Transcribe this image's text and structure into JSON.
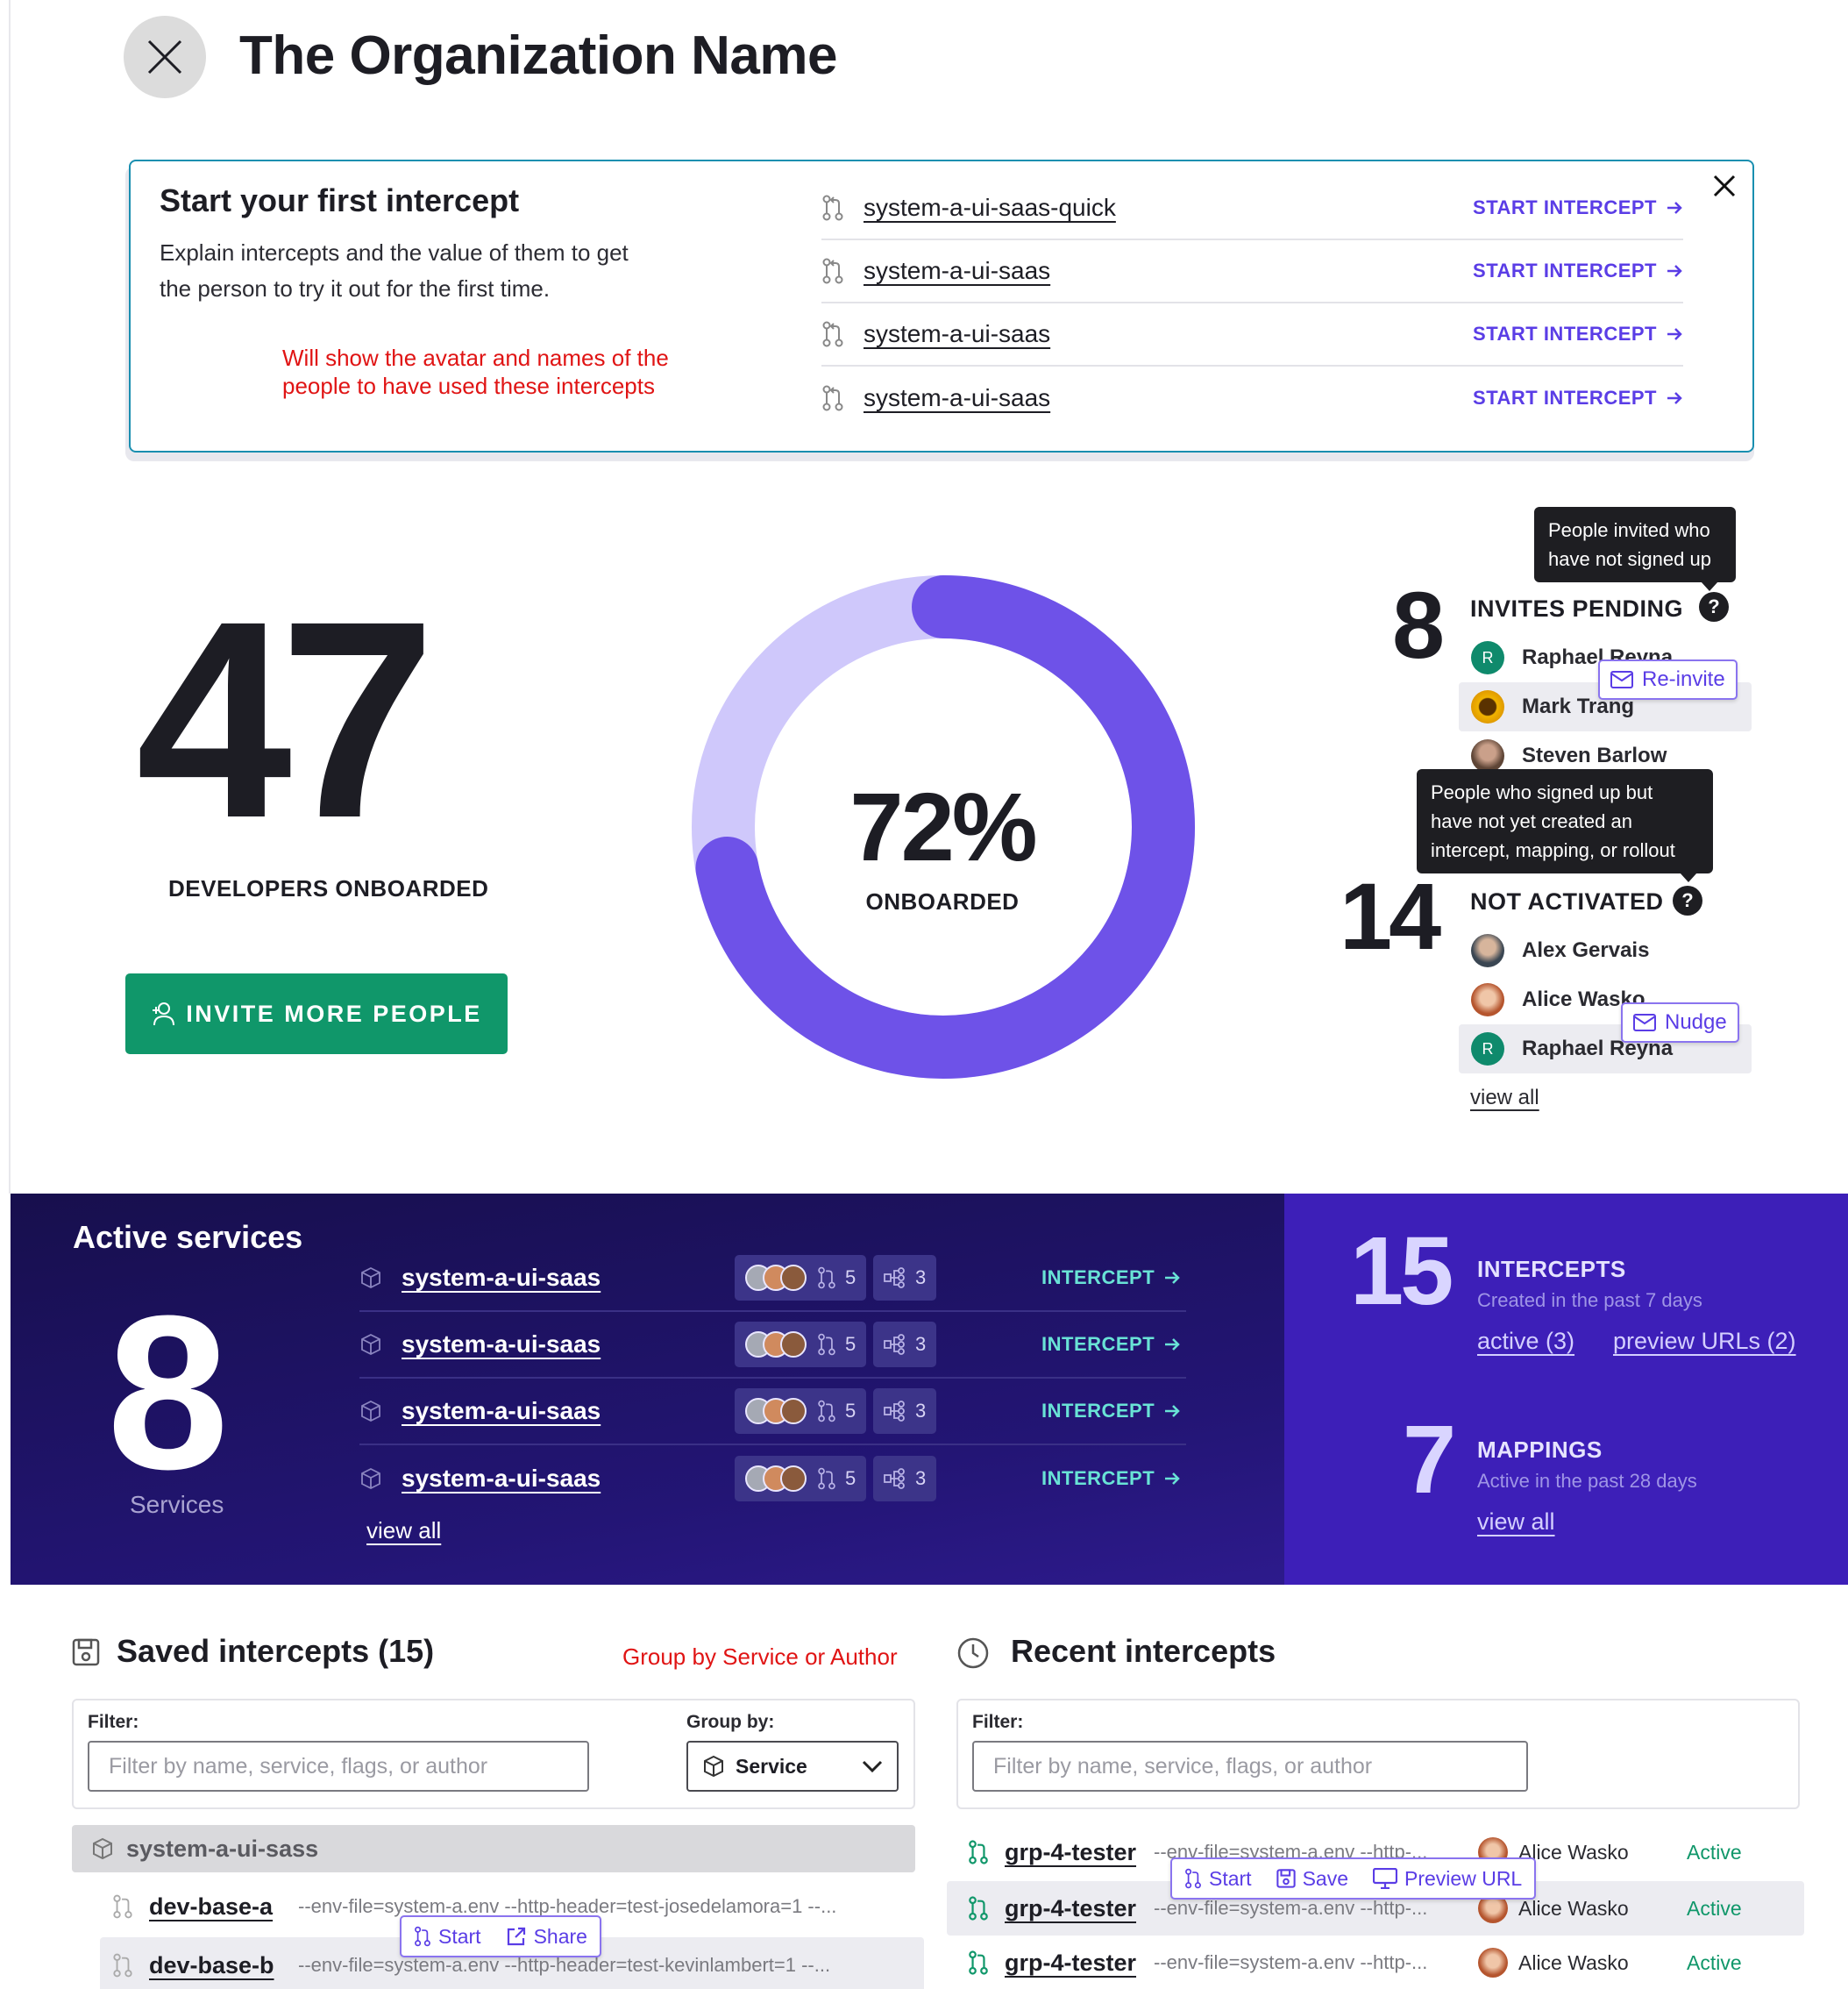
{
  "header": {
    "title": "The Organization Name"
  },
  "first_intercept": {
    "title": "Start your first intercept",
    "description": "Explain intercepts and the value of them to get the person to try it out for the first time.",
    "note": "Will show the avatar and names of the people to have used these intercepts",
    "action_label": "START INTERCEPT",
    "items": [
      "system-a-ui-saas-quick",
      "system-a-ui-saas",
      "system-a-ui-saas",
      "system-a-ui-saas"
    ]
  },
  "onboarding": {
    "developers_count": "47",
    "developers_label": "DEVELOPERS ONBOARDED",
    "invite_button": "INVITE MORE PEOPLE",
    "percent_text": "72%",
    "percent_value": 72,
    "percent_label": "ONBOARDED",
    "colors": {
      "ring_bg": "#cfc8fb",
      "ring_fg": "#6e52e8"
    }
  },
  "invites": {
    "count": "8",
    "label": "INVITES PENDING",
    "tooltip": "People invited who have not signed up",
    "reinvite_label": "Re-invite",
    "people": [
      "Raphael Reyna",
      "Mark Trang",
      "Steven Barlow"
    ]
  },
  "not_activated": {
    "count": "14",
    "label": "NOT ACTIVATED",
    "tooltip": "People who signed up but have not yet created an intercept, mapping, or rollout",
    "nudge_label": "Nudge",
    "people": [
      "Alex Gervais",
      "Alice Wasko",
      "Raphael Reyna"
    ],
    "view_all": "view all"
  },
  "active_services": {
    "title": "Active services",
    "count": "8",
    "count_label": "Services",
    "action_label": "INTERCEPT",
    "view_all": "view all",
    "rows": [
      {
        "name": "system-a-ui-saas",
        "intercepts": "5",
        "mappings": "3"
      },
      {
        "name": "system-a-ui-saas",
        "intercepts": "5",
        "mappings": "3"
      },
      {
        "name": "system-a-ui-saas",
        "intercepts": "5",
        "mappings": "3"
      },
      {
        "name": "system-a-ui-saas",
        "intercepts": "5",
        "mappings": "3"
      }
    ]
  },
  "intercepts_stat": {
    "count": "15",
    "title": "INTERCEPTS",
    "subtitle": "Created in the past 7 days",
    "active_link": "active (3)",
    "preview_link": "preview URLs (2)"
  },
  "mappings_stat": {
    "count": "7",
    "title": "MAPPINGS",
    "subtitle": "Active in the past 28 days",
    "view_all": "view all"
  },
  "saved_intercepts": {
    "title": "Saved intercepts (15)",
    "group_note": "Group by Service or Author",
    "filter_label": "Filter:",
    "filter_placeholder": "Filter by name, service, flags, or author",
    "group_label": "Group by:",
    "group_value": "Service",
    "group_header": "system-a-ui-sass",
    "start_label": "Start",
    "share_label": "Share",
    "rows": [
      {
        "name": "dev-base-a",
        "args": "--env-file=system-a.env --http-header=test-josedelamora=1 --..."
      },
      {
        "name": "dev-base-b",
        "args": "--env-file=system-a.env --http-header=test-kevinlambert=1 --..."
      }
    ]
  },
  "recent_intercepts": {
    "title": "Recent intercepts",
    "filter_label": "Filter:",
    "filter_placeholder": "Filter by name, service, flags, or author",
    "start_label": "Start",
    "save_label": "Save",
    "preview_label": "Preview URL",
    "rows": [
      {
        "name": "grp-4-tester",
        "args": "--env-file=system-a.env --http-...",
        "author": "Alice Wasko",
        "status": "Active"
      },
      {
        "name": "grp-4-tester",
        "args": "--env-file=system-a.env --http-...",
        "author": "Alice Wasko",
        "status": "Active"
      },
      {
        "name": "grp-4-tester",
        "args": "--env-file=system-a.env --http-...",
        "author": "Alice Wasko",
        "status": "Active"
      }
    ]
  }
}
